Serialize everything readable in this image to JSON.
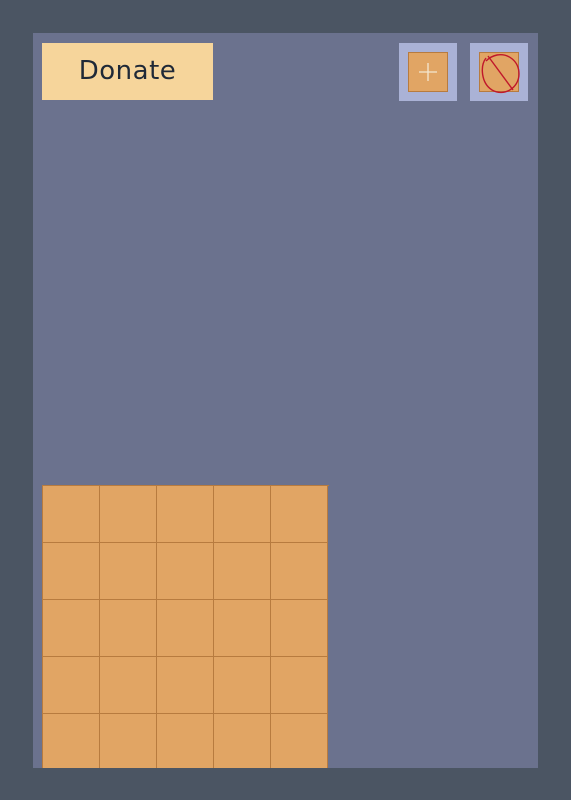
{
  "toolbar": {
    "donate_label": "Donate",
    "add_tile_icon": "plus-icon",
    "clear_tiles_icon": "no-tile-icon"
  },
  "board": {
    "columns": 5,
    "visible_rows": 5,
    "tile_color": "#e1a564",
    "tile_border_color": "#b77b3f",
    "background_color": "#6b728e",
    "frame_color": "#4b5563"
  },
  "colors": {
    "donate_background": "#f6d59b",
    "tool_button_background": "#aab2d6",
    "clear_icon_stroke": "#c0182b"
  }
}
